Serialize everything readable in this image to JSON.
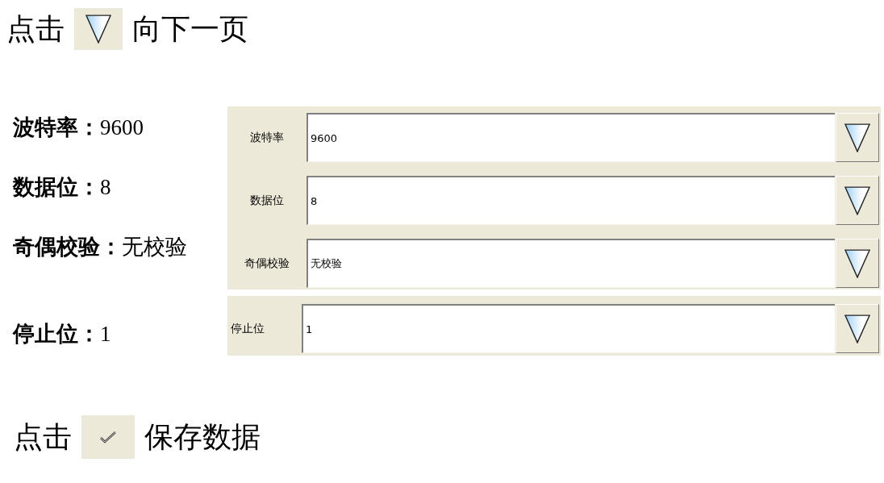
{
  "header": {
    "prefix": "点击",
    "suffix": "向下一页"
  },
  "settings": [
    {
      "label": "波特率：",
      "value": "9600"
    },
    {
      "label": "数据位：",
      "value": "8"
    },
    {
      "label": "奇偶校验：",
      "value": "无校验"
    },
    {
      "label": "停止位：",
      "value": "1"
    }
  ],
  "panel": {
    "groups": [
      {
        "rows": [
          {
            "label": "波特率",
            "value": "9600"
          },
          {
            "label": "数据位",
            "value": "8"
          },
          {
            "label": "奇偶校验",
            "value": "无校验"
          }
        ]
      },
      {
        "rows": [
          {
            "label": "停止位",
            "value": "1"
          }
        ]
      }
    ]
  },
  "footer": {
    "prefix": "点击",
    "suffix": "保存数据"
  }
}
